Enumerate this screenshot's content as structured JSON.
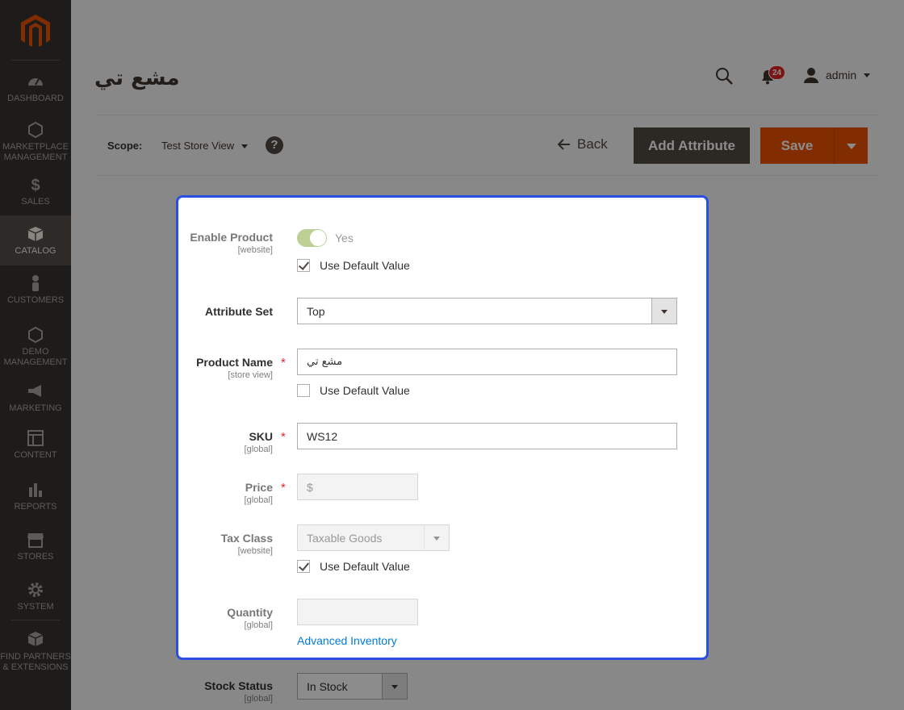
{
  "header": {
    "page_title": "مشع تي",
    "notifications_count": "24",
    "user_name": "admin"
  },
  "sidebar": {
    "items": [
      {
        "label": "Dashboard",
        "icon": "dashboard-icon"
      },
      {
        "label": "Marketplace Management",
        "icon": "hexagon-icon"
      },
      {
        "label": "Sales",
        "icon": "dollar-icon"
      },
      {
        "label": "Catalog",
        "icon": "box-icon",
        "active": true
      },
      {
        "label": "Customers",
        "icon": "person-icon"
      },
      {
        "label": "Demo Management",
        "icon": "hexagon-icon"
      },
      {
        "label": "Marketing",
        "icon": "megaphone-icon"
      },
      {
        "label": "Content",
        "icon": "layout-icon"
      },
      {
        "label": "Reports",
        "icon": "bar-chart-icon"
      },
      {
        "label": "Stores",
        "icon": "store-icon"
      },
      {
        "label": "System",
        "icon": "gear-icon"
      },
      {
        "label": "Find Partners & Extensions",
        "icon": "cubes-icon"
      }
    ]
  },
  "toolbar": {
    "scope_label": "Scope:",
    "scope_value": "Test Store View",
    "help": "?",
    "back_label": "Back",
    "add_attribute_label": "Add Attribute",
    "save_label": "Save"
  },
  "form": {
    "enable_product": {
      "label": "Enable Product",
      "scope": "[website]",
      "value": "Yes",
      "use_default": "Use Default Value"
    },
    "attribute_set": {
      "label": "Attribute Set",
      "value": "Top"
    },
    "product_name": {
      "label": "Product Name",
      "scope": "[store view]",
      "value": "مشع تي",
      "use_default": "Use Default Value"
    },
    "sku": {
      "label": "SKU",
      "scope": "[global]",
      "value": "WS12"
    },
    "price": {
      "label": "Price",
      "scope": "[global]",
      "prefix": "$"
    },
    "tax_class": {
      "label": "Tax Class",
      "scope": "[website]",
      "value": "Taxable Goods",
      "use_default": "Use Default Value"
    },
    "quantity": {
      "label": "Quantity",
      "scope": "[global]",
      "link": "Advanced Inventory"
    },
    "stock_status": {
      "label": "Stock Status",
      "scope": "[global]",
      "value": "In Stock"
    }
  },
  "colors": {
    "sidebar_bg": "#373330",
    "accent_orange": "#eb5202",
    "focus_border": "#2b4fe0"
  }
}
